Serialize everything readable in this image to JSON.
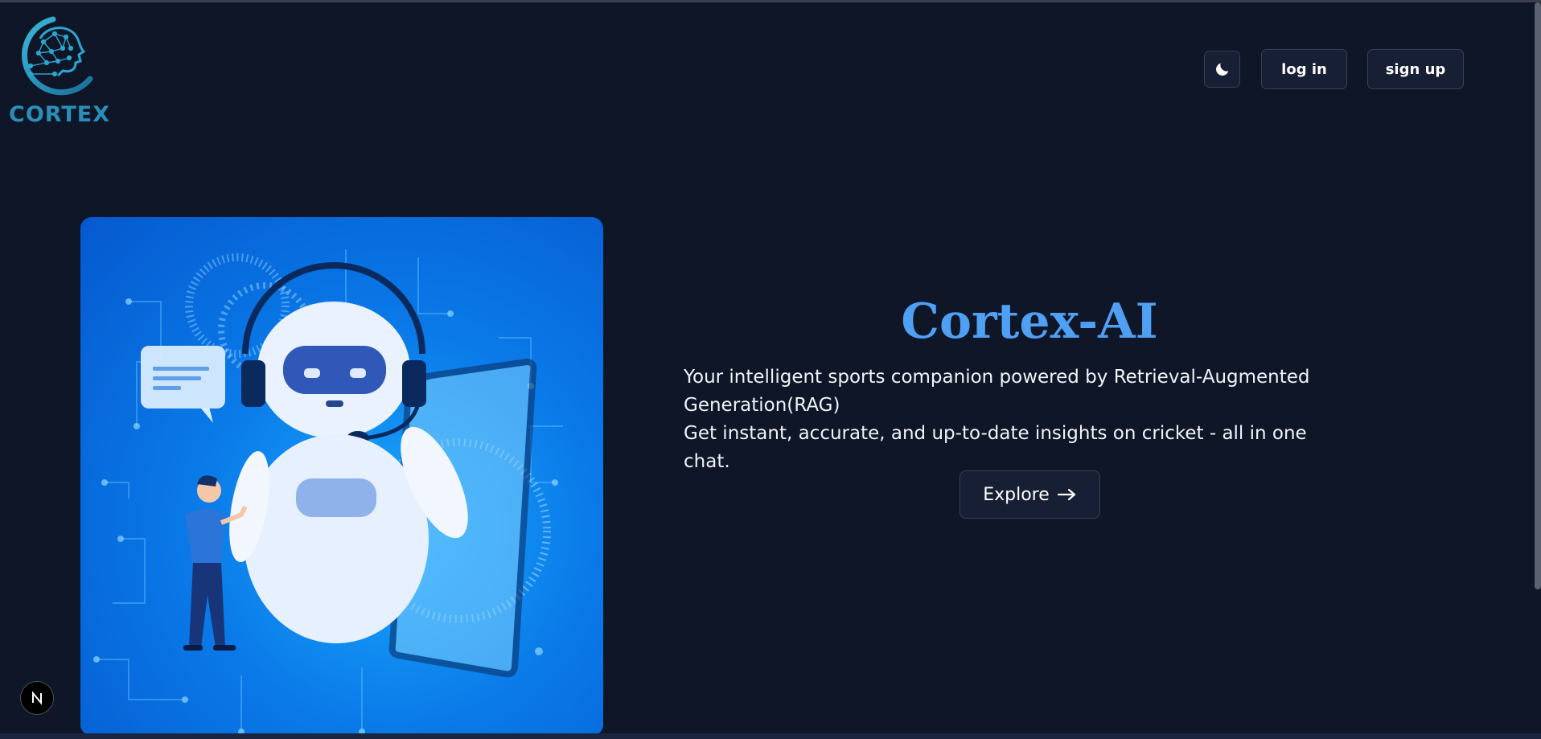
{
  "brand": {
    "name": "CORTEX",
    "logo_icon": "brain-head-icon",
    "color": "#2a8fb8"
  },
  "header": {
    "theme_toggle_icon": "moon-icon",
    "login_label": "log in",
    "signup_label": "sign up"
  },
  "hero": {
    "title": "Cortex-AI",
    "title_color": "#4f9ff2",
    "line1": "Your intelligent sports companion powered by Retrieval-Augmented Generation(RAG)",
    "line2": "Get instant, accurate, and up-to-date insights on cricket - all in one chat.",
    "explore_label": "Explore",
    "explore_icon": "arrow-right-icon",
    "illustration": "robot-assistant-illustration"
  },
  "colors": {
    "background": "#0e1628",
    "button_bg": "#161f33",
    "button_border": "#374055"
  },
  "dev_badge": {
    "icon": "next-logo-icon"
  }
}
